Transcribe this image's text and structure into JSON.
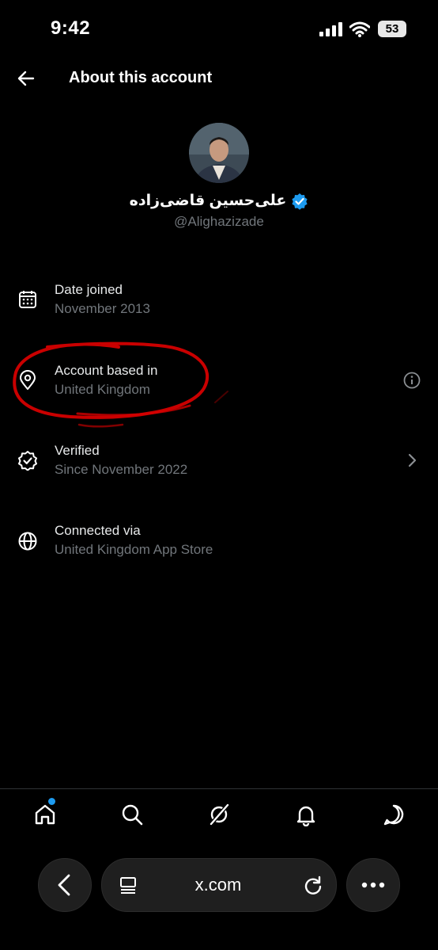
{
  "status_bar": {
    "time": "9:42",
    "battery": "53",
    "signal_icon": "signal-bars-icon",
    "wifi_icon": "wifi-icon"
  },
  "header": {
    "title": "About this account",
    "back_icon": "arrow-left-icon"
  },
  "profile": {
    "display_name": "علی‌حسین قاضی‌زاده",
    "handle": "@Alighazizade",
    "verified": true,
    "badge_color": "#1d9bf0"
  },
  "rows": [
    {
      "label": "Date joined",
      "value": "November 2013",
      "icon": "calendar-icon"
    },
    {
      "label": "Account based in",
      "value": "United Kingdom",
      "icon": "location-pin-icon",
      "trailing_icon": "info-icon"
    },
    {
      "label": "Verified",
      "value": "Since November 2022",
      "icon": "verified-badge-icon",
      "trailing_icon": "chevron-right-icon"
    },
    {
      "label": "Connected via",
      "value": "United Kingdom App Store",
      "icon": "globe-icon"
    }
  ],
  "annotation": {
    "color": "#d40000",
    "description": "hand-drawn red circle around Account based in"
  },
  "tab_bar": {
    "tabs": [
      "home-icon",
      "search-icon",
      "grok-icon",
      "notifications-icon",
      "messages-icon"
    ],
    "active": "home-icon",
    "dot_color": "#1d9bf0"
  },
  "browser": {
    "url": "x.com",
    "icons": [
      "back-icon",
      "tabs-icon",
      "reload-icon",
      "more-icon"
    ]
  },
  "colors": {
    "background": "#000000",
    "primary_text": "#e7e9ea",
    "secondary_text": "#71767b"
  }
}
